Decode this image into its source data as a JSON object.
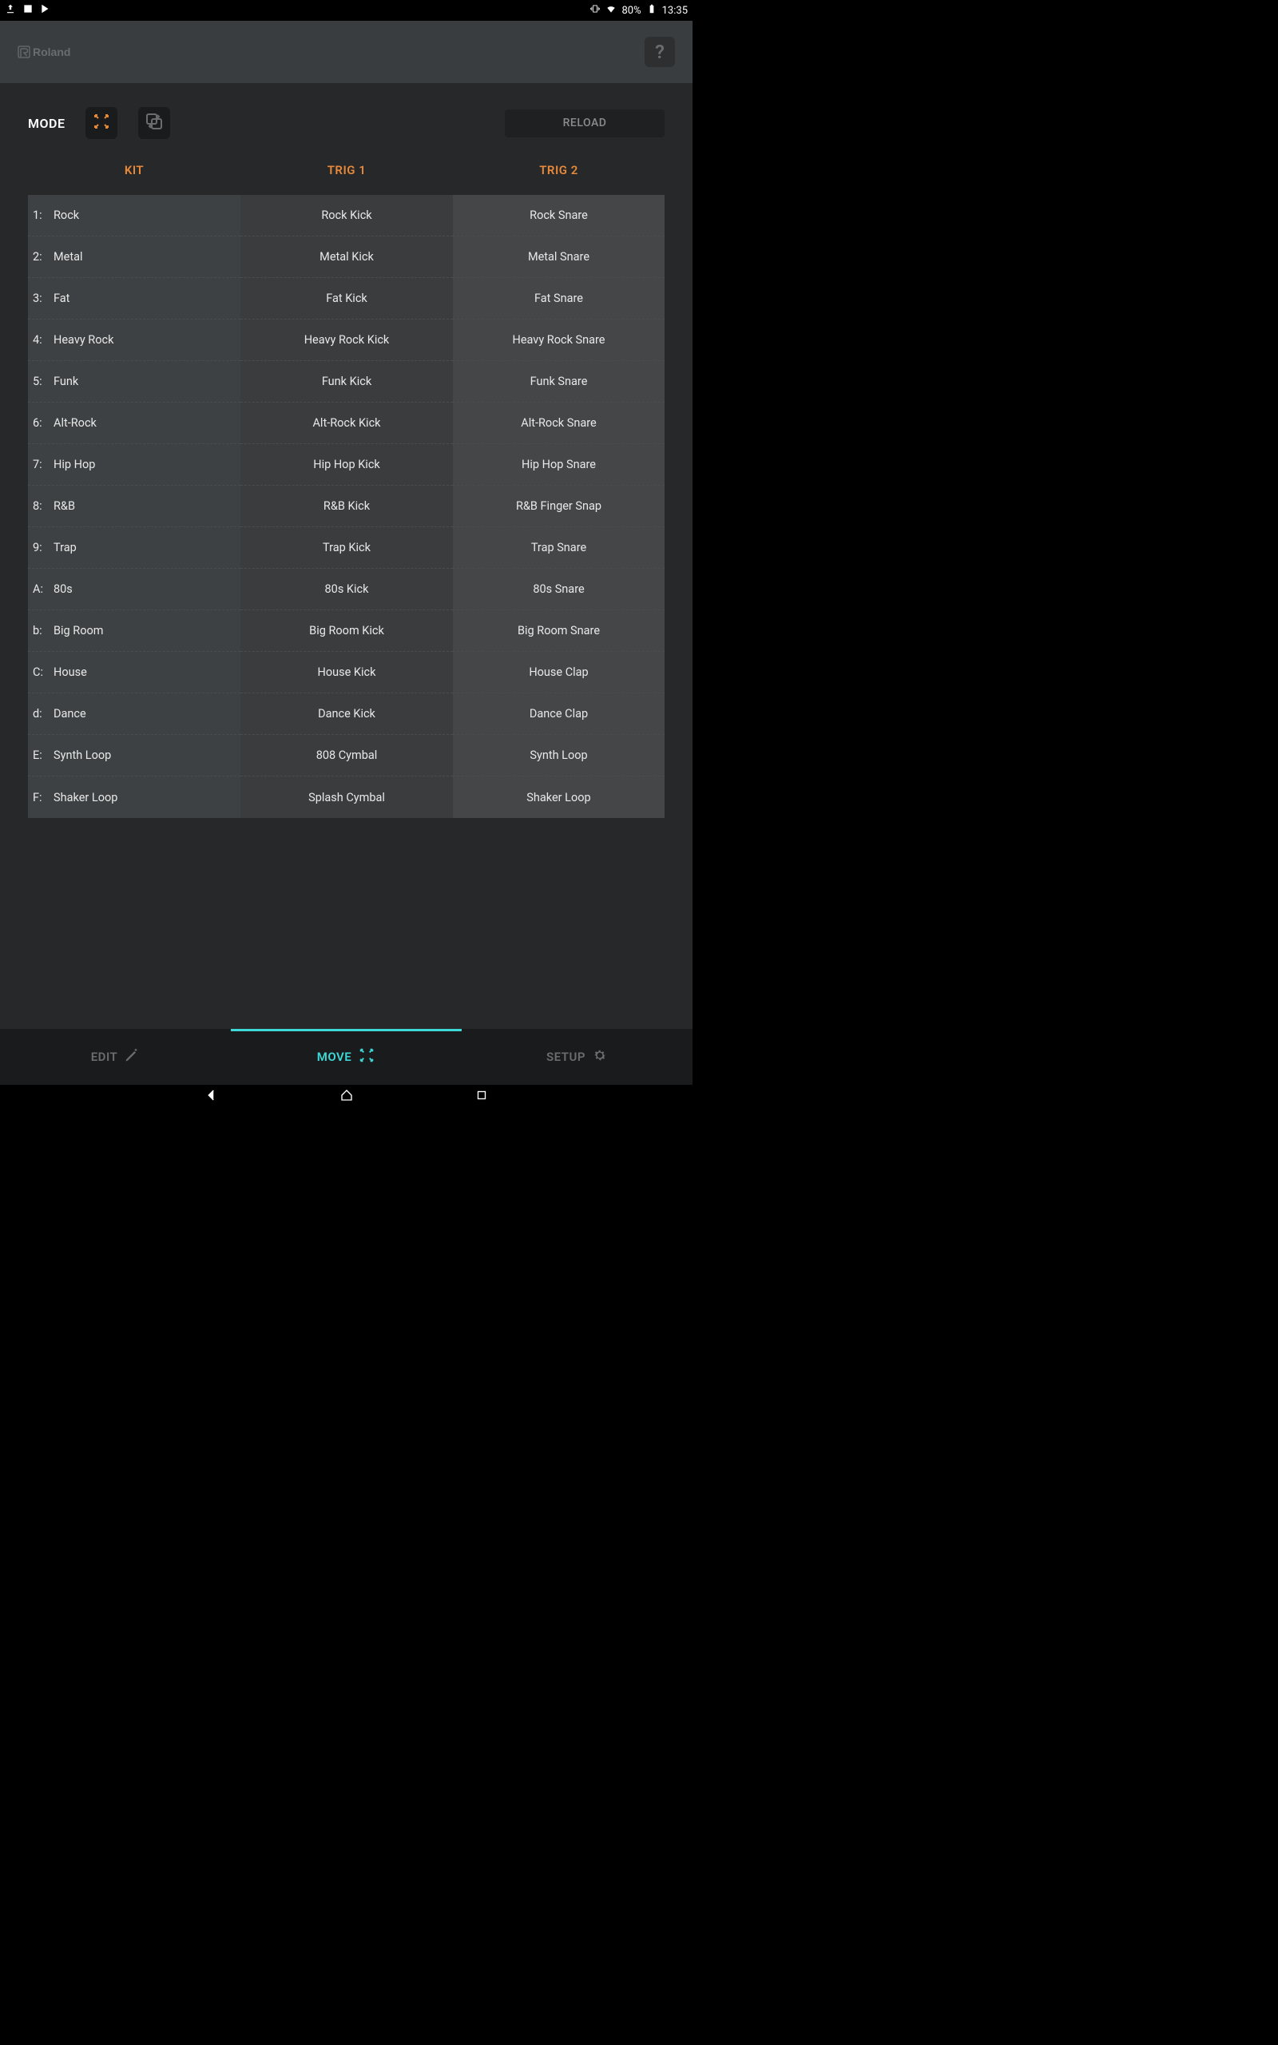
{
  "status_bar": {
    "battery_pct": "80%",
    "clock": "13:35"
  },
  "header": {
    "brand": "Roland",
    "help": "?"
  },
  "mode": {
    "label": "MODE",
    "reload": "RELOAD"
  },
  "columns": {
    "kit": "KIT",
    "trig1": "TRIG 1",
    "trig2": "TRIG 2"
  },
  "kits": [
    {
      "idx": "1:",
      "name": "Rock",
      "t1": "Rock Kick",
      "t2": "Rock Snare"
    },
    {
      "idx": "2:",
      "name": "Metal",
      "t1": "Metal Kick",
      "t2": "Metal Snare"
    },
    {
      "idx": "3:",
      "name": "Fat",
      "t1": "Fat Kick",
      "t2": "Fat Snare"
    },
    {
      "idx": "4:",
      "name": "Heavy Rock",
      "t1": "Heavy Rock Kick",
      "t2": "Heavy Rock Snare"
    },
    {
      "idx": "5:",
      "name": "Funk",
      "t1": "Funk Kick",
      "t2": "Funk Snare"
    },
    {
      "idx": "6:",
      "name": "Alt-Rock",
      "t1": "Alt-Rock Kick",
      "t2": "Alt-Rock Snare"
    },
    {
      "idx": "7:",
      "name": "Hip Hop",
      "t1": "Hip Hop Kick",
      "t2": "Hip Hop Snare"
    },
    {
      "idx": "8:",
      "name": "R&B",
      "t1": "R&B Kick",
      "t2": "R&B Finger Snap"
    },
    {
      "idx": "9:",
      "name": "Trap",
      "t1": "Trap Kick",
      "t2": "Trap Snare"
    },
    {
      "idx": "A:",
      "name": "80s",
      "t1": "80s Kick",
      "t2": "80s Snare"
    },
    {
      "idx": "b:",
      "name": "Big Room",
      "t1": "Big Room Kick",
      "t2": "Big Room Snare"
    },
    {
      "idx": "C:",
      "name": "House",
      "t1": "House Kick",
      "t2": "House Clap"
    },
    {
      "idx": "d:",
      "name": "Dance",
      "t1": "Dance Kick",
      "t2": "Dance Clap"
    },
    {
      "idx": "E:",
      "name": "Synth Loop",
      "t1": "808 Cymbal",
      "t2": "Synth Loop"
    },
    {
      "idx": "F:",
      "name": "Shaker Loop",
      "t1": "Splash Cymbal",
      "t2": "Shaker Loop"
    }
  ],
  "nav": {
    "edit": "EDIT",
    "move": "MOVE",
    "setup": "SETUP"
  }
}
